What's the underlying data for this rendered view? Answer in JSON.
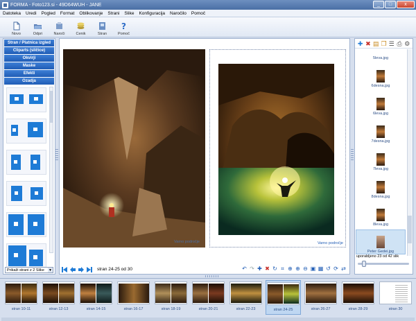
{
  "window": {
    "title": "FORMA - Foto123.si - 49D64WUH - JANE",
    "buttons": [
      "_",
      "□",
      "x"
    ]
  },
  "menu": [
    "Datoteka",
    "Uredi",
    "Pogled",
    "Format",
    "Oblikovanje",
    "Strani",
    "Slike",
    "Konfiguracija",
    "Naročilo",
    "Pomoč"
  ],
  "toolbar": [
    {
      "label": "Novo",
      "icon": "new-document-icon"
    },
    {
      "label": "Odpri",
      "icon": "open-folder-icon"
    },
    {
      "label": "Naroči",
      "icon": "order-icon"
    },
    {
      "label": "Cenik",
      "icon": "price-list-icon"
    },
    {
      "label": "Stran",
      "icon": "page-icon"
    },
    {
      "label": "Pomoč",
      "icon": "help-icon"
    }
  ],
  "left_panel": {
    "sections": [
      "Stran / Platnica izgled",
      "Cliparts (sličice)",
      "Okvirji",
      "Maske",
      "Efekti",
      "Ozadja"
    ],
    "layout_count": 6,
    "filter_select": "Prikaži strani z 2 Slike"
  },
  "canvas": {
    "right_area_label": "Varno področje",
    "left_area_label": "Varno področje",
    "page_info": "stran 24-25 od 30"
  },
  "right_panel": {
    "images": [
      "5leva.jpg",
      "6desna.jpg",
      "6leva.jpg",
      "7desna.jpg",
      "7leva.jpg",
      "8desna.jpg",
      "8leva.jpg",
      "Peter Gedei.jpg"
    ],
    "selected_image": "Peter Gedei.jpg",
    "usage": "uporabljeno 23 od 42 slik"
  },
  "filmstrip": [
    {
      "label": "stran 10-11"
    },
    {
      "label": "stran 12-13"
    },
    {
      "label": "stran 14-15"
    },
    {
      "label": "stran 16-17"
    },
    {
      "label": "stran 18-19"
    },
    {
      "label": "stran 20-21"
    },
    {
      "label": "stran 22-23"
    },
    {
      "label": "stran 24-25",
      "selected": true
    },
    {
      "label": "stran 26-27"
    },
    {
      "label": "stran 28-29"
    },
    {
      "label": "stran 30"
    }
  ],
  "colors": {
    "accent": "#1f5cb5",
    "panel_bg": "#d6dfee",
    "selection": "#bfd7f2"
  }
}
